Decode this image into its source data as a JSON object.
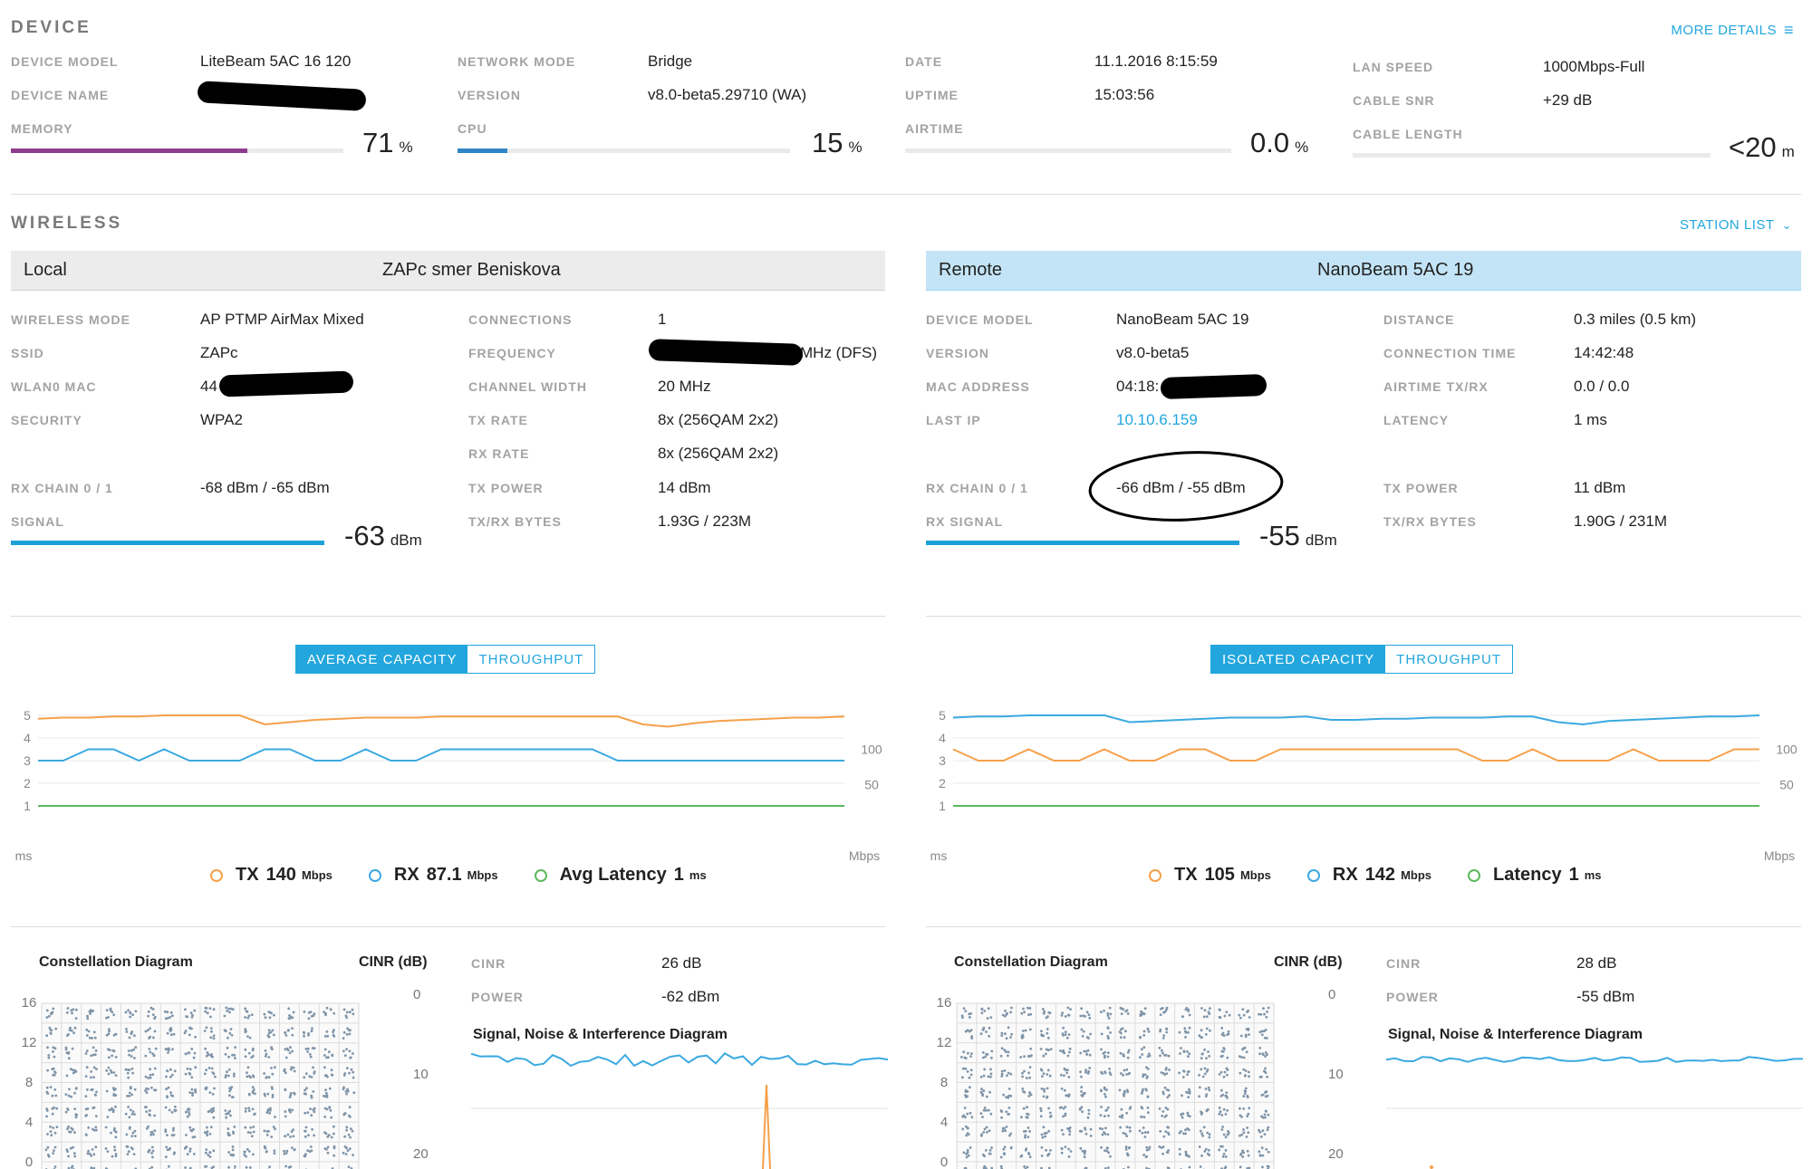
{
  "device": {
    "title": "DEVICE",
    "more_details": "MORE DETAILS",
    "model_label": "DEVICE MODEL",
    "model_value": "LiteBeam 5AC 16 120",
    "name_label": "DEVICE NAME",
    "memory_label": "MEMORY",
    "memory_value": "71",
    "memory_unit": "%",
    "memory_fraction": 0.71,
    "network_mode_label": "NETWORK MODE",
    "network_mode_value": "Bridge",
    "version_label": "VERSION",
    "version_value": "v8.0-beta5.29710 (WA)",
    "cpu_label": "CPU",
    "cpu_value": "15",
    "cpu_unit": "%",
    "cpu_fraction": 0.15,
    "date_label": "DATE",
    "date_value": "11.1.2016 8:15:59",
    "uptime_label": "UPTIME",
    "uptime_value": "15:03:56",
    "airtime_label": "AIRTIME",
    "airtime_value": "0.0",
    "airtime_unit": "%",
    "lan_speed_label": "LAN SPEED",
    "lan_speed_value": "1000Mbps-Full",
    "cable_snr_label": "CABLE SNR",
    "cable_snr_value": "+29 dB",
    "cable_length_label": "CABLE LENGTH",
    "cable_length_value": "<20",
    "cable_length_unit": "m"
  },
  "wireless": {
    "title": "WIRELESS",
    "station_list": "STATION LIST",
    "local": {
      "header_label": "Local",
      "header_name": "ZAPc smer Beniskova",
      "wireless_mode_label": "WIRELESS MODE",
      "wireless_mode_value": "AP PTMP AirMax Mixed",
      "ssid_label": "SSID",
      "ssid_value": "ZAPc",
      "wlan_mac_label": "WLAN0 MAC",
      "wlan_mac_value": "44",
      "security_label": "SECURITY",
      "security_value": "WPA2",
      "rx_chain_label": "RX CHAIN 0 / 1",
      "rx_chain_value": "-68 dBm / -65 dBm",
      "signal_label": "SIGNAL",
      "signal_value": "-63",
      "signal_unit": "dBm",
      "connections_label": "CONNECTIONS",
      "connections_value": "1",
      "frequency_label": "FREQUENCY",
      "frequency_value": "MHz (DFS)",
      "channel_width_label": "CHANNEL WIDTH",
      "channel_width_value": "20 MHz",
      "tx_rate_label": "TX RATE",
      "tx_rate_value": "8x (256QAM 2x2)",
      "rx_rate_label": "RX RATE",
      "rx_rate_value": "8x (256QAM 2x2)",
      "tx_power_label": "TX POWER",
      "tx_power_value": "14 dBm",
      "txrx_bytes_label": "TX/RX BYTES",
      "txrx_bytes_value": "1.93G / 223M"
    },
    "remote": {
      "header_label": "Remote",
      "header_name": "NanoBeam 5AC 19",
      "device_model_label": "DEVICE MODEL",
      "device_model_value": "NanoBeam 5AC 19",
      "version_label": "VERSION",
      "version_value": "v8.0-beta5",
      "mac_label": "MAC ADDRESS",
      "mac_value": "04:18:",
      "last_ip_label": "LAST IP",
      "last_ip_value": "10.10.6.159",
      "rx_chain_label": "RX CHAIN 0 / 1",
      "rx_chain_value": "-66 dBm / -55 dBm",
      "rx_signal_label": "RX SIGNAL",
      "rx_signal_value": "-55",
      "rx_signal_unit": "dBm",
      "distance_label": "DISTANCE",
      "distance_value": "0.3 miles (0.5 km)",
      "conn_time_label": "CONNECTION TIME",
      "conn_time_value": "14:42:48",
      "airtime_label": "AIRTIME TX/RX",
      "airtime_value": "0.0 / 0.0",
      "latency_label": "LATENCY",
      "latency_value": "1 ms",
      "tx_power_label": "TX POWER",
      "tx_power_value": "11 dBm",
      "txrx_bytes_label": "TX/RX BYTES",
      "txrx_bytes_value": "1.90G / 231M"
    }
  },
  "capacity": {
    "left": {
      "tab_active": "AVERAGE CAPACITY",
      "tab_other": "THROUGHPUT",
      "left_unit": "ms",
      "right_unit": "Mbps",
      "legend": [
        {
          "name": "TX",
          "value": "140",
          "unit": "Mbps",
          "color": "#f5a04a"
        },
        {
          "name": "RX",
          "value": "87.1",
          "unit": "Mbps",
          "color": "#3ba9e0"
        },
        {
          "name": "Avg Latency",
          "value": "1",
          "unit": "ms",
          "color": "#5cb85c"
        }
      ]
    },
    "right": {
      "tab_active": "ISOLATED CAPACITY",
      "tab_other": "THROUGHPUT",
      "left_unit": "ms",
      "right_unit": "Mbps",
      "legend": [
        {
          "name": "TX",
          "value": "105",
          "unit": "Mbps",
          "color": "#f5a04a"
        },
        {
          "name": "RX",
          "value": "142",
          "unit": "Mbps",
          "color": "#3ba9e0"
        },
        {
          "name": "Latency",
          "value": "1",
          "unit": "ms",
          "color": "#5cb85c"
        }
      ]
    }
  },
  "chart_data": [
    {
      "type": "line",
      "title": "",
      "left_axis_ticks": [
        "1",
        "2",
        "3",
        "4",
        "5"
      ],
      "right_axis_ticks": [
        "50",
        "100"
      ],
      "ylabel_left": "ms",
      "ylabel_right": "Mbps",
      "series": [
        {
          "name": "TX",
          "color": "#f5a04a",
          "values": [
            4.85,
            4.9,
            4.9,
            4.95,
            4.95,
            5,
            5,
            5,
            5,
            4.6,
            4.7,
            4.8,
            4.85,
            4.9,
            4.9,
            4.9,
            4.95,
            4.95,
            4.95,
            4.95,
            4.95,
            4.95,
            4.95,
            4.95,
            4.6,
            4.5,
            4.65,
            4.75,
            4.8,
            4.85,
            4.9,
            4.9,
            4.95
          ]
        },
        {
          "name": "RX",
          "color": "#3ba9e0",
          "values": [
            3,
            3,
            3.5,
            3.5,
            3,
            3.5,
            3,
            3,
            3,
            3.5,
            3.5,
            3,
            3,
            3.5,
            3,
            3,
            3.5,
            3.5,
            3.5,
            3.5,
            3.5,
            3.5,
            3.5,
            3,
            3,
            3,
            3,
            3,
            3,
            3,
            3,
            3,
            3
          ]
        },
        {
          "name": "Avg Latency",
          "color": "#5cb85c",
          "values": [
            1,
            1,
            1,
            1,
            1,
            1,
            1,
            1,
            1,
            1,
            1,
            1,
            1,
            1,
            1,
            1,
            1,
            1,
            1,
            1,
            1,
            1,
            1,
            1,
            1,
            1,
            1,
            1,
            1,
            1,
            1,
            1,
            1
          ]
        }
      ]
    },
    {
      "type": "line",
      "title": "",
      "left_axis_ticks": [
        "1",
        "2",
        "3",
        "4",
        "5"
      ],
      "right_axis_ticks": [
        "50",
        "100"
      ],
      "ylabel_left": "ms",
      "ylabel_right": "Mbps",
      "series": [
        {
          "name": "TX",
          "color": "#f5a04a",
          "values": [
            3.5,
            3,
            3,
            3.5,
            3,
            3,
            3.5,
            3,
            3,
            3.5,
            3.5,
            3,
            3,
            3.5,
            3.5,
            3.5,
            3.5,
            3.5,
            3.5,
            3.5,
            3.5,
            3,
            3,
            3.5,
            3,
            3,
            3,
            3.5,
            3,
            3,
            3,
            3.5,
            3.5
          ]
        },
        {
          "name": "RX",
          "color": "#3ba9e0",
          "values": [
            4.9,
            4.95,
            4.95,
            5,
            5,
            5,
            5,
            4.7,
            4.75,
            4.8,
            4.85,
            4.9,
            4.9,
            4.9,
            4.95,
            4.8,
            4.8,
            4.85,
            4.85,
            4.9,
            4.9,
            4.9,
            4.95,
            4.95,
            4.7,
            4.6,
            4.75,
            4.8,
            4.85,
            4.9,
            4.95,
            4.95,
            5
          ]
        },
        {
          "name": "Latency",
          "color": "#5cb85c",
          "values": [
            1,
            1,
            1,
            1,
            1,
            1,
            1,
            1,
            1,
            1,
            1,
            1,
            1,
            1,
            1,
            1,
            1,
            1,
            1,
            1,
            1,
            1,
            1,
            1,
            1,
            1,
            1,
            1,
            1,
            1,
            1,
            1,
            1
          ]
        }
      ]
    }
  ],
  "diagrams": {
    "left": {
      "constellation_title": "Constellation Diagram",
      "cinr_title": "CINR (dB)",
      "constellation_ticks": [
        "16",
        "12",
        "8",
        "4",
        "0"
      ],
      "cinr_ticks": [
        "0",
        "10",
        "20"
      ],
      "cinr_label": "CINR",
      "cinr_value": "26 dB",
      "power_label": "POWER",
      "power_value": "-62 dBm",
      "sni_title": "Signal, Noise & Interference Diagram"
    },
    "right": {
      "constellation_title": "Constellation Diagram",
      "cinr_title": "CINR (dB)",
      "constellation_ticks": [
        "16",
        "12",
        "8",
        "4",
        "0"
      ],
      "cinr_ticks": [
        "0",
        "10",
        "20"
      ],
      "cinr_label": "CINR",
      "cinr_value": "28 dB",
      "power_label": "POWER",
      "power_value": "-55 dBm",
      "sni_title": "Signal, Noise & Interference Diagram"
    }
  }
}
